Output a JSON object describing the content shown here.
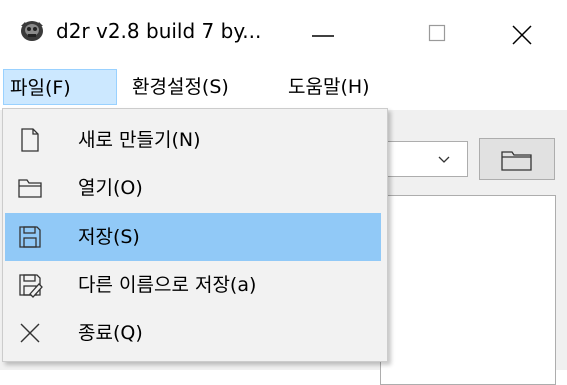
{
  "window": {
    "title": "d2r v2.8 build 7 by...",
    "min_glyph": "—",
    "max_glyph": "☐",
    "close_glyph": "✕"
  },
  "menubar": {
    "file": "파일(F)",
    "settings": "환경설정(S)",
    "help": "도움말(H)"
  },
  "file_menu": {
    "items": [
      {
        "label": "새로 만들기(N)",
        "icon": "new-file-icon"
      },
      {
        "label": "열기(O)",
        "icon": "open-folder-icon"
      },
      {
        "label": "저장(S)",
        "icon": "save-icon"
      },
      {
        "label": "다른 이름으로 저장(a)",
        "icon": "save-as-icon"
      },
      {
        "label": "종료(Q)",
        "icon": "close-icon"
      }
    ],
    "highlighted_index": 2
  },
  "colors": {
    "highlight": "#91c9f7",
    "menu_active": "#cce8ff",
    "menu_bg": "#f2f2f2"
  }
}
